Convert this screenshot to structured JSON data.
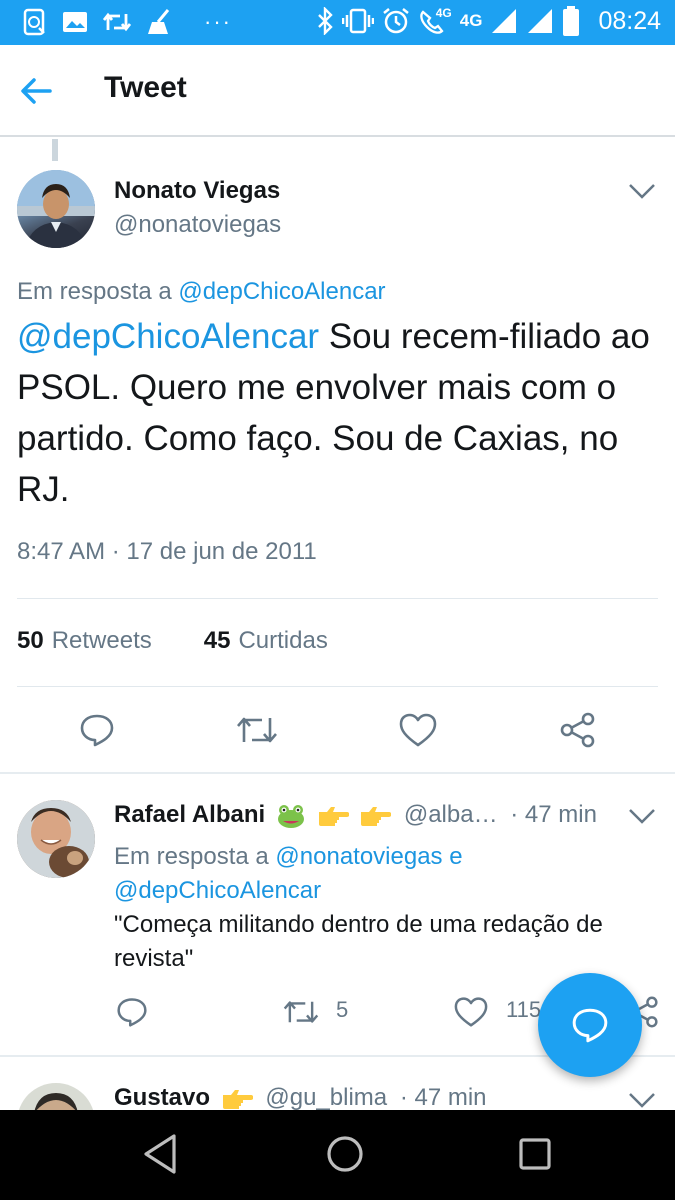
{
  "status_bar": {
    "time": "08:24",
    "network": "4G",
    "call_network": "4G",
    "overflow": "···",
    "icons": [
      "sync-icon",
      "image-icon",
      "retweet-icon",
      "broom-icon",
      "bluetooth-icon",
      "vibrate-icon",
      "alarm-icon",
      "wifi-call-icon",
      "signal-icon",
      "battery-icon"
    ]
  },
  "header": {
    "title": "Tweet",
    "back_icon": "back-arrow-icon"
  },
  "tweet": {
    "author_name": "Nonato Viegas",
    "author_handle": "@nonatoviegas",
    "reply_prefix": "Em resposta a",
    "reply_to": "@depChicoAlencar",
    "mention": "@depChicoAlencar",
    "text_body": " Sou recem-filiado ao PSOL. Quero me envolver mais com o partido. Como faço. Sou de Caxias, no RJ.",
    "timestamp": "8:47 AM · 17 de jun de 2011",
    "retweets_count": "50",
    "retweets_label": "Retweets",
    "likes_count": "45",
    "likes_label": "Curtidas",
    "actions": [
      "reply-icon",
      "retweet-icon",
      "like-icon",
      "share-icon"
    ]
  },
  "replies": [
    {
      "name": "Rafael Albani",
      "emojis": [
        "frog-emoji",
        "pointing-right-emoji",
        "pointing-right-emoji"
      ],
      "handle": "@alba…",
      "time": "· 47 min",
      "reply_prefix": "Em resposta a",
      "reply_to_1": "@nonatoviegas",
      "reply_joiner": "e",
      "reply_to_2": "@depChicoAlencar",
      "text": "\"Começa militando dentro de uma redação de revista\"",
      "retweet_count": "5",
      "like_count": "115"
    },
    {
      "name": "Gustavo",
      "emojis": [
        "pointing-right-emoji"
      ],
      "handle": "@gu_blima",
      "time": "· 47 min"
    }
  ],
  "fab": {
    "icon": "compose-reply-icon"
  },
  "colors": {
    "accent": "#1da1f2",
    "link": "#1b95e0",
    "muted": "#657786",
    "text": "#14171a"
  },
  "nav": {
    "icons": [
      "back-triangle-icon",
      "home-circle-icon",
      "recents-square-icon"
    ]
  }
}
